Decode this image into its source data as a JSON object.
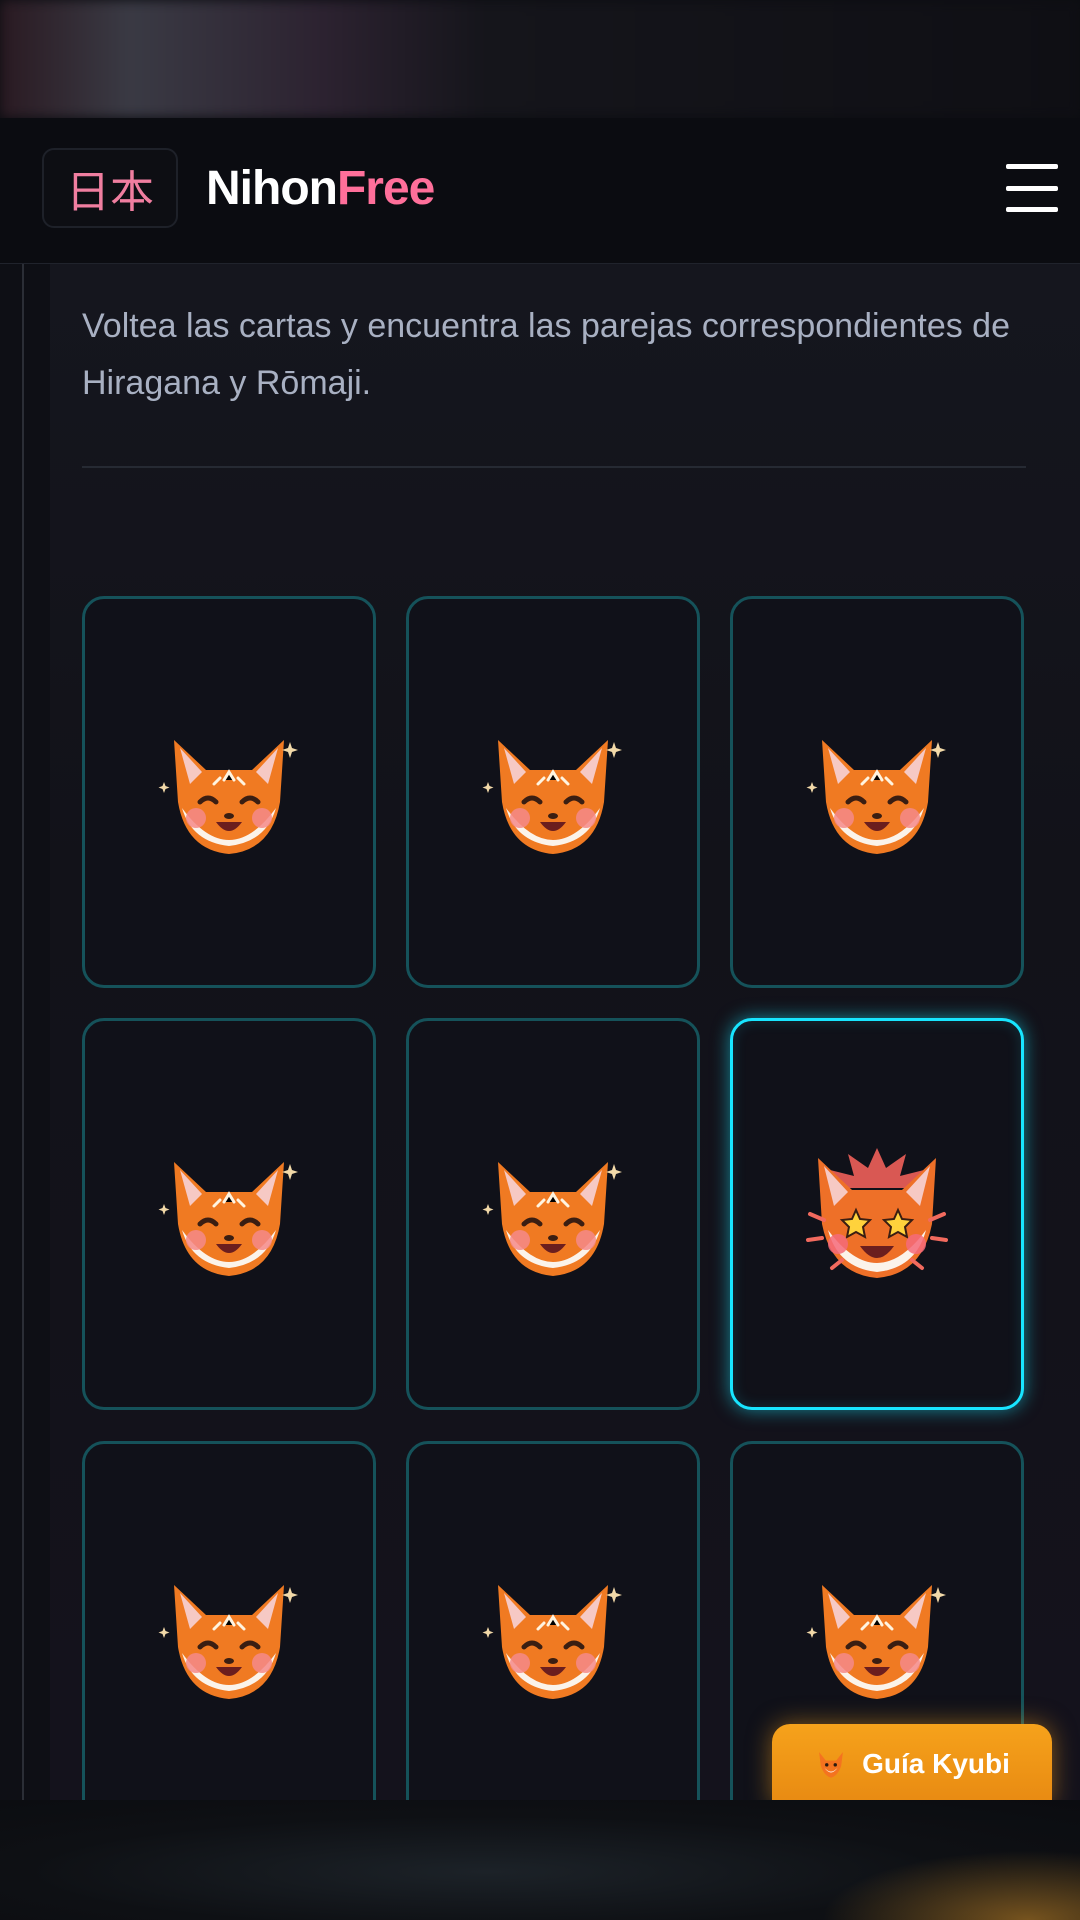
{
  "header": {
    "logo_kanji": "日本",
    "brand_part1": "Nihon",
    "brand_part2": "Free",
    "menu_icon": "hamburger-menu-icon"
  },
  "main": {
    "description": "Voltea las cartas y encuentra las parejas correspondientes de Hiragana y Rōmaji.",
    "cards": [
      {
        "state": "face-down",
        "icon": "happy-fox-icon"
      },
      {
        "state": "face-down",
        "icon": "happy-fox-icon"
      },
      {
        "state": "face-down",
        "icon": "happy-fox-icon"
      },
      {
        "state": "face-down",
        "icon": "happy-fox-icon"
      },
      {
        "state": "face-down",
        "icon": "happy-fox-icon"
      },
      {
        "state": "selected",
        "icon": "excited-fox-icon"
      },
      {
        "state": "face-down",
        "icon": "happy-fox-icon"
      },
      {
        "state": "face-down",
        "icon": "happy-fox-icon"
      },
      {
        "state": "face-down",
        "icon": "happy-fox-icon"
      }
    ]
  },
  "guide": {
    "label": "Guía Kyubi",
    "icon": "fox-icon"
  },
  "colors": {
    "accent_pink": "#ff6f9a",
    "card_border": "#15525a",
    "card_active_border": "#18e5ff",
    "guide_button": "#f39a18"
  }
}
